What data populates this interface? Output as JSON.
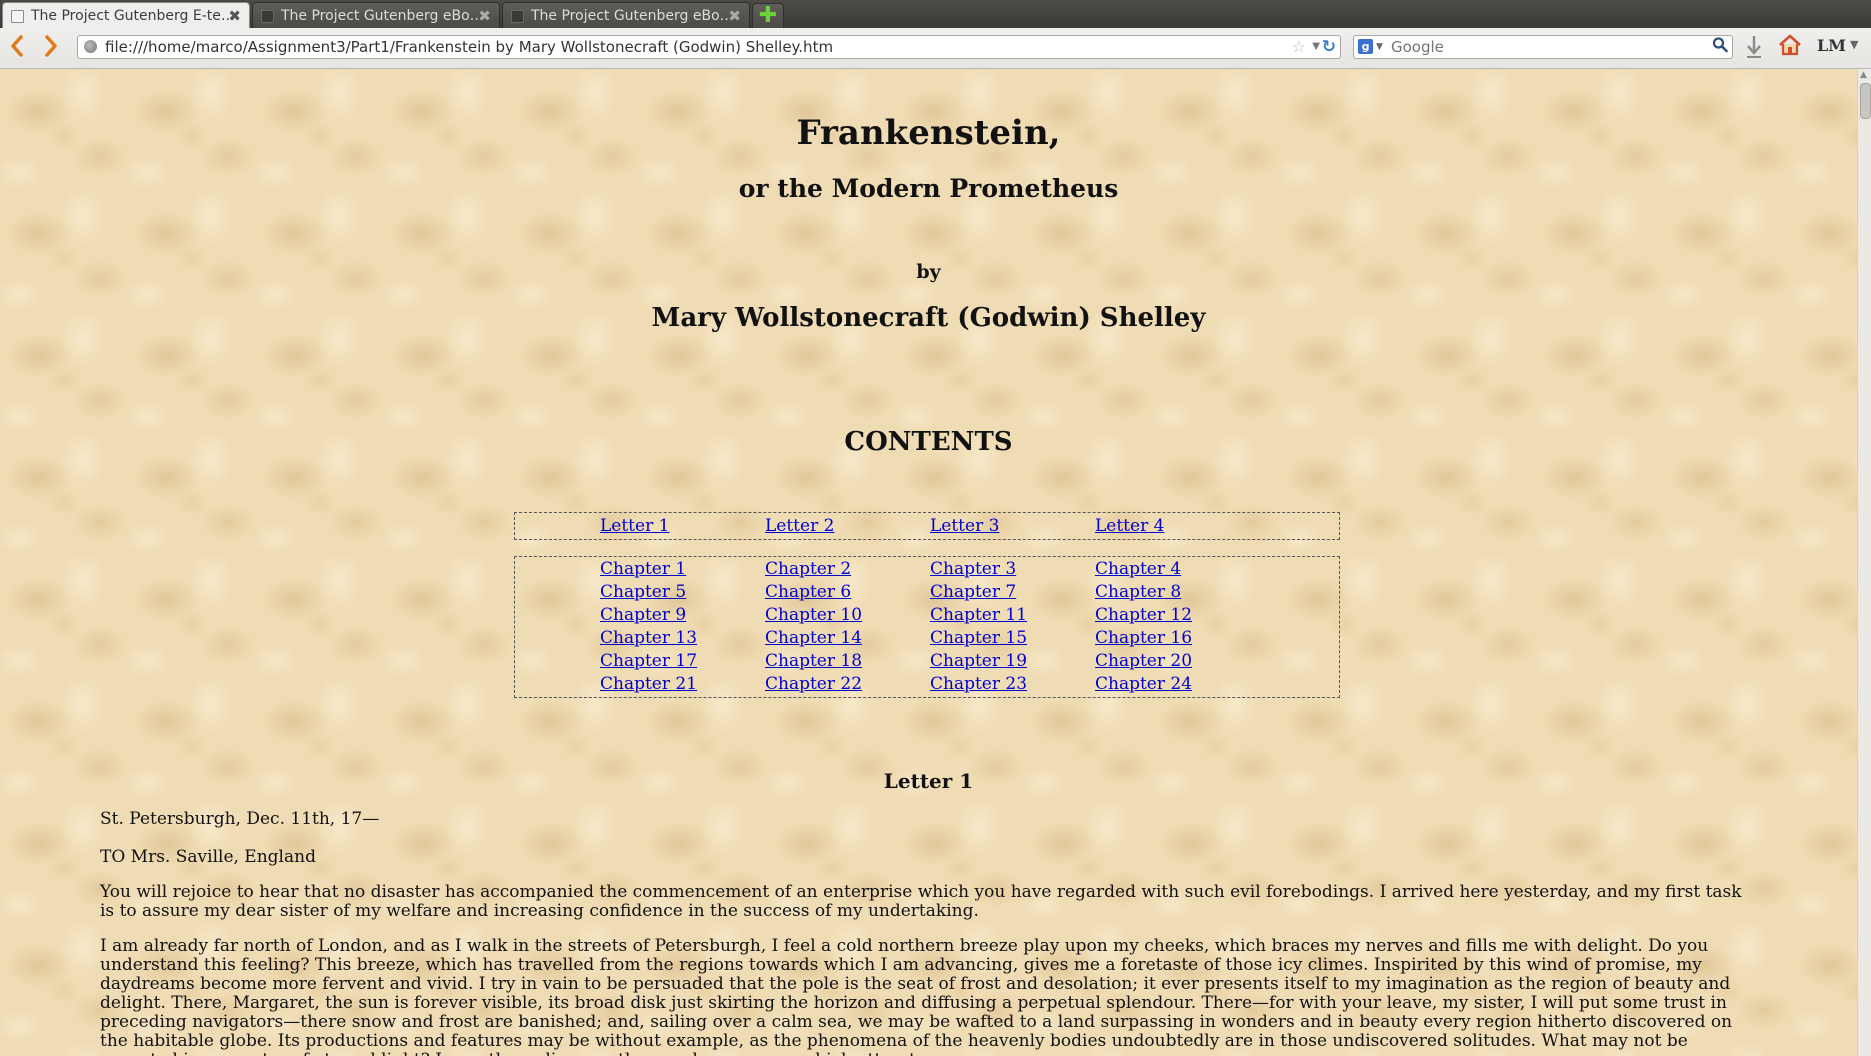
{
  "browser": {
    "tabs": [
      {
        "title": "The Project Gutenberg E-te…",
        "active": true
      },
      {
        "title": "The Project Gutenberg eBo…",
        "active": false
      },
      {
        "title": "The Project Gutenberg eBo…",
        "active": false
      }
    ],
    "new_tab_symbol": "✚",
    "close_symbol": "✖",
    "url": "file:///home/marco/Assignment3/Part1/Frankenstein by Mary Wollstonecraft (Godwin) Shelley.htm",
    "search_placeholder": "Google",
    "search_engine_letter": "g",
    "toolbar_label_lm": "LM",
    "icons": {
      "back": "back-arrow-icon",
      "forward": "forward-arrow-icon",
      "reload": "reload-icon",
      "bookmark": "star-icon",
      "search": "magnifier-icon",
      "download": "download-icon",
      "home": "home-icon"
    }
  },
  "page": {
    "title": "Frankenstein,",
    "subtitle": "or the Modern Prometheus",
    "by": "by",
    "author": "Mary Wollstonecraft (Godwin) Shelley",
    "contents_heading": "CONTENTS",
    "letters": [
      "Letter 1",
      "Letter 2",
      "Letter 3",
      "Letter 4"
    ],
    "chapters": [
      "Chapter 1",
      "Chapter 2",
      "Chapter 3",
      "Chapter 4",
      "Chapter 5",
      "Chapter 6",
      "Chapter 7",
      "Chapter 8",
      "Chapter 9",
      "Chapter 10",
      "Chapter 11",
      "Chapter 12",
      "Chapter 13",
      "Chapter 14",
      "Chapter 15",
      "Chapter 16",
      "Chapter 17",
      "Chapter 18",
      "Chapter 19",
      "Chapter 20",
      "Chapter 21",
      "Chapter 22",
      "Chapter 23",
      "Chapter 24"
    ],
    "letter1_heading": "Letter 1",
    "place_date": "St. Petersburgh, Dec. 11th, 17—",
    "addressee": "TO Mrs. Saville, England",
    "paragraphs": [
      "You will rejoice to hear that no disaster has accompanied the commencement of an enterprise which you have regarded with such evil forebodings. I arrived here yesterday, and my first task is to assure my dear sister of my welfare and increasing confidence in the success of my undertaking.",
      "I am already far north of London, and as I walk in the streets of Petersburgh, I feel a cold northern breeze play upon my cheeks, which braces my nerves and fills me with delight. Do you understand this feeling? This breeze, which has travelled from the regions towards which I am advancing, gives me a foretaste of those icy climes. Inspirited by this wind of promise, my daydreams become more fervent and vivid. I try in vain to be persuaded that the pole is the seat of frost and desolation; it ever presents itself to my imagination as the region of beauty and delight. There, Margaret, the sun is forever visible, its broad disk just skirting the horizon and diffusing a perpetual splendour. There—for with your leave, my sister, I will put some trust in preceding navigators—there snow and frost are banished; and, sailing over a calm sea, we may be wafted to a land surpassing in wonders and in beauty every region hitherto discovered on the habitable globe. Its productions and features may be without example, as the phenomena of the heavenly bodies undoubtedly are in those undiscovered solitudes. What may not be expected in a country of eternal light? I may there discover the wondrous power which attracts"
    ]
  }
}
